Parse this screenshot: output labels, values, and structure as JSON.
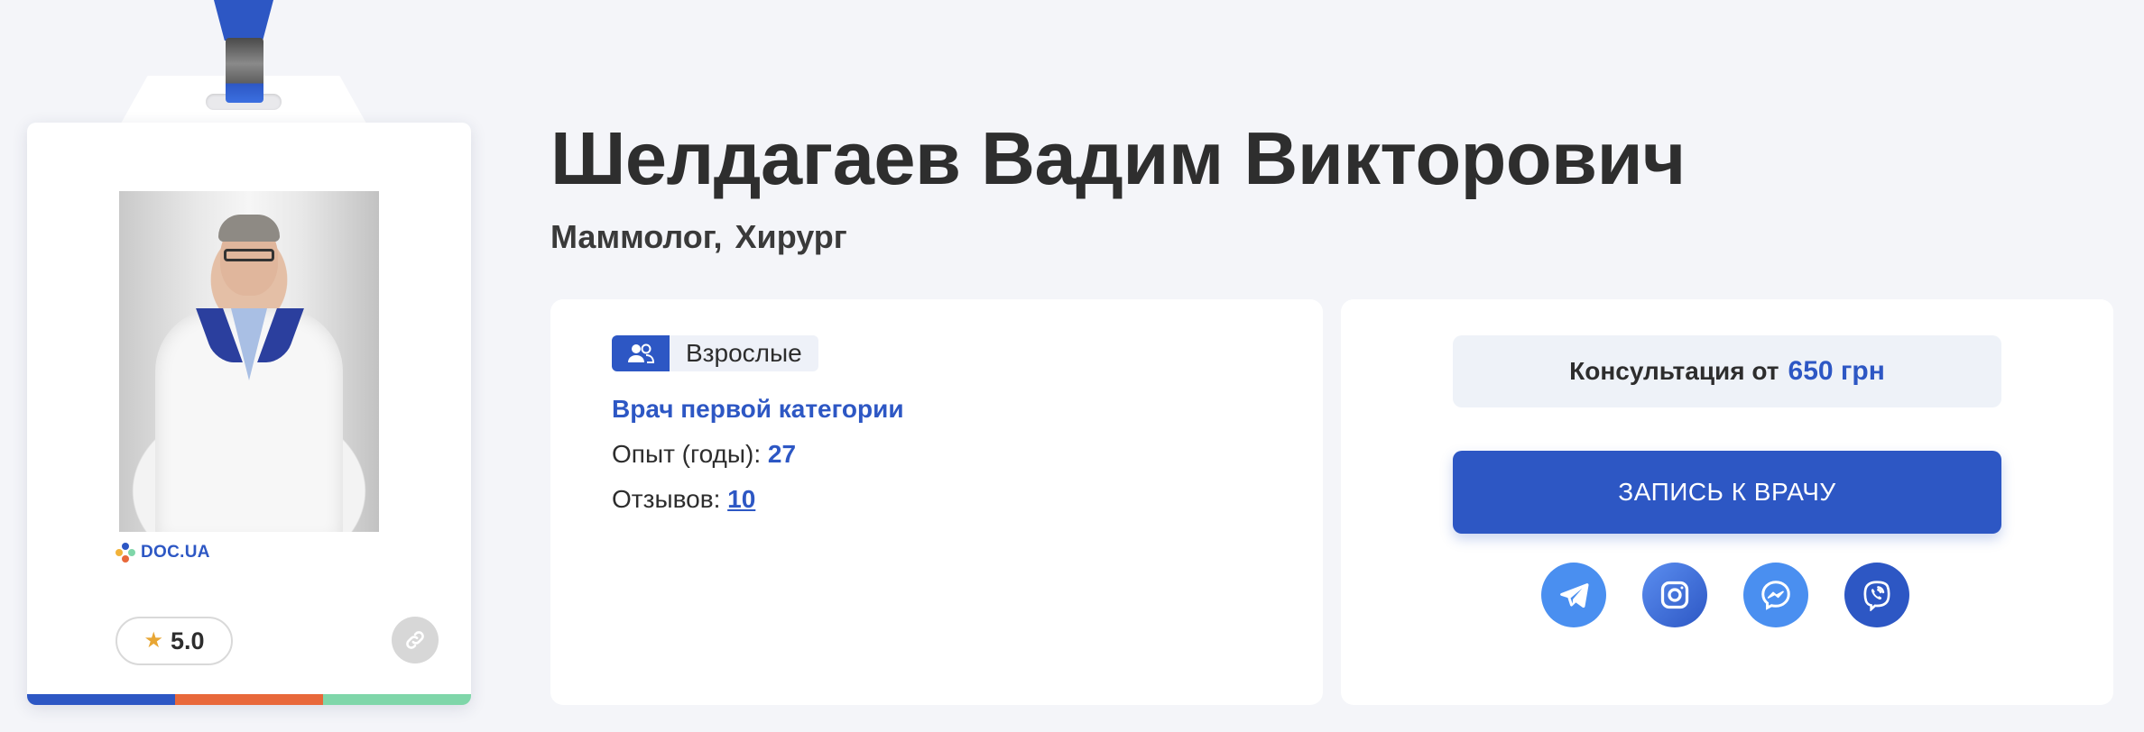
{
  "doctor": {
    "name": "Шелдагаев Вадим Викторович",
    "specialties": [
      "Маммолог,",
      "Хирург"
    ]
  },
  "badge": {
    "brand": "DOC.UA",
    "rating": "5.0",
    "stripe_colors": [
      "#2d57c4",
      "#e8683a",
      "#7fd6a9"
    ]
  },
  "info": {
    "age_group": "Взрослые",
    "category": "Врач первой категории",
    "experience_label": "Опыт (годы):",
    "experience_value": "27",
    "reviews_label": "Отзывов:",
    "reviews_value": "10"
  },
  "booking": {
    "price_label": "Консультация от",
    "price_value": "650 грн",
    "button_label": "ЗАПИСЬ К ВРАЧУ",
    "socials": [
      {
        "name": "telegram-icon",
        "color": "#4a8ff0"
      },
      {
        "name": "instagram-icon",
        "color": "#3a72e0"
      },
      {
        "name": "messenger-icon",
        "color": "#4a8ff0"
      },
      {
        "name": "viber-icon",
        "color": "#2d57c4"
      }
    ]
  },
  "colors": {
    "accent": "#2d57c4",
    "background": "#f4f5f9",
    "text": "#2d2d2d"
  }
}
